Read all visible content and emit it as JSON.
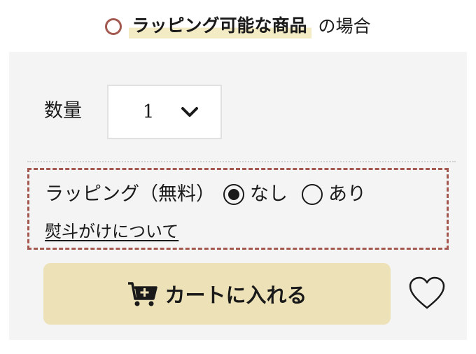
{
  "caption": {
    "highlight": "ラッピング可能な商品",
    "suffix": "の場合"
  },
  "quantity": {
    "label": "数量",
    "value": "1"
  },
  "wrapping": {
    "label": "ラッピング（無料）",
    "options": [
      {
        "label": "なし",
        "checked": true
      },
      {
        "label": "あり",
        "checked": false
      }
    ],
    "noshi_link": "熨斗がけについて"
  },
  "cart": {
    "label": "カートに入れる",
    "icon": "cart-add-icon"
  },
  "favorite": {
    "icon": "heart-icon"
  },
  "colors": {
    "accent": "#a3594f",
    "button_bg": "#ede1b8",
    "panel_bg": "#f4f4f4",
    "highlight": "#f3ebc4"
  }
}
